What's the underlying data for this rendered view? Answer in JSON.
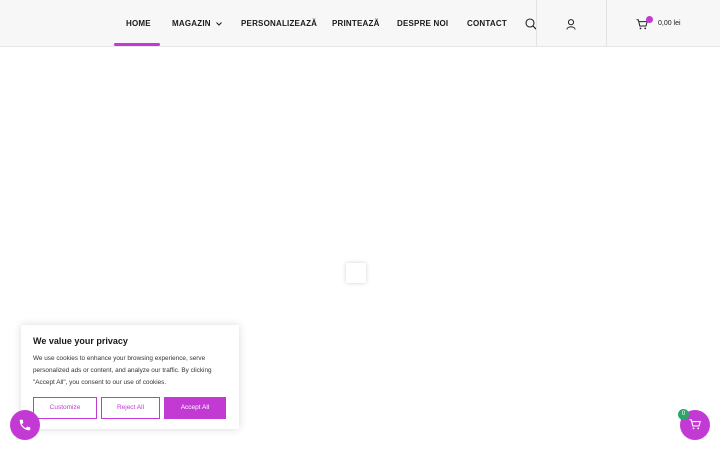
{
  "nav": {
    "home": "HOME",
    "shop": "MAGAZIN",
    "customize": "PERSONALIZEAZĂ",
    "print": "PRINTEAZĂ",
    "about": "DESPRE NOI",
    "contact": "CONTACT"
  },
  "cart": {
    "total": "0,00 lei"
  },
  "cookie": {
    "title": "We value your privacy",
    "text": "We use cookies to enhance your browsing experience, serve personalized ads or content, and analyze our traffic. By clicking \"Accept All\", you consent to our use of cookies.",
    "customize": "Customize",
    "reject": "Reject All",
    "accept": "Accept All"
  },
  "floating_cart": {
    "count": "0"
  },
  "colors": {
    "accent": "#c23ad3",
    "badge_green": "#2ea36b"
  },
  "icons": [
    "chevron-down-icon",
    "search-icon",
    "user-icon",
    "cart-icon",
    "phone-icon",
    "cart-icon"
  ]
}
